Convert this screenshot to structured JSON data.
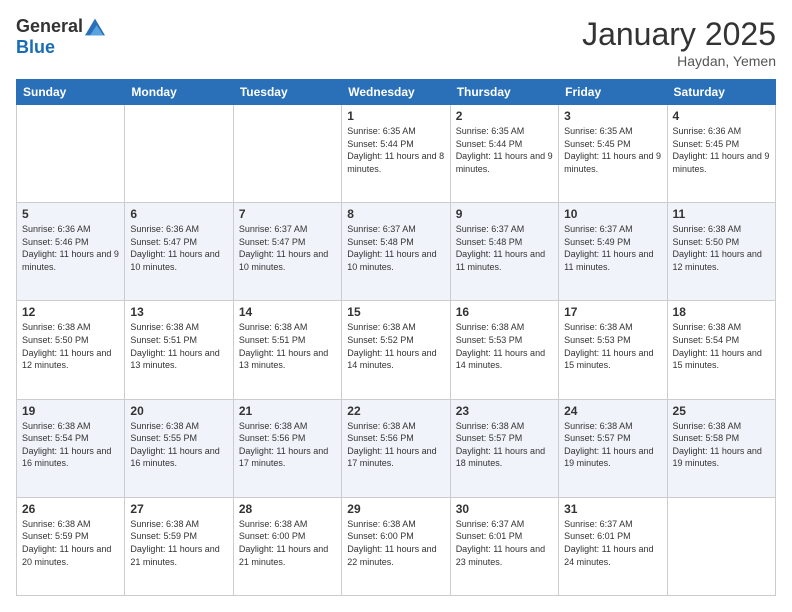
{
  "logo": {
    "general": "General",
    "blue": "Blue"
  },
  "header": {
    "month": "January 2025",
    "location": "Haydan, Yemen"
  },
  "weekdays": [
    "Sunday",
    "Monday",
    "Tuesday",
    "Wednesday",
    "Thursday",
    "Friday",
    "Saturday"
  ],
  "weeks": [
    [
      {
        "day": "",
        "sunrise": "",
        "sunset": "",
        "daylight": ""
      },
      {
        "day": "",
        "sunrise": "",
        "sunset": "",
        "daylight": ""
      },
      {
        "day": "",
        "sunrise": "",
        "sunset": "",
        "daylight": ""
      },
      {
        "day": "1",
        "sunrise": "Sunrise: 6:35 AM",
        "sunset": "Sunset: 5:44 PM",
        "daylight": "Daylight: 11 hours and 8 minutes."
      },
      {
        "day": "2",
        "sunrise": "Sunrise: 6:35 AM",
        "sunset": "Sunset: 5:44 PM",
        "daylight": "Daylight: 11 hours and 9 minutes."
      },
      {
        "day": "3",
        "sunrise": "Sunrise: 6:35 AM",
        "sunset": "Sunset: 5:45 PM",
        "daylight": "Daylight: 11 hours and 9 minutes."
      },
      {
        "day": "4",
        "sunrise": "Sunrise: 6:36 AM",
        "sunset": "Sunset: 5:45 PM",
        "daylight": "Daylight: 11 hours and 9 minutes."
      }
    ],
    [
      {
        "day": "5",
        "sunrise": "Sunrise: 6:36 AM",
        "sunset": "Sunset: 5:46 PM",
        "daylight": "Daylight: 11 hours and 9 minutes."
      },
      {
        "day": "6",
        "sunrise": "Sunrise: 6:36 AM",
        "sunset": "Sunset: 5:47 PM",
        "daylight": "Daylight: 11 hours and 10 minutes."
      },
      {
        "day": "7",
        "sunrise": "Sunrise: 6:37 AM",
        "sunset": "Sunset: 5:47 PM",
        "daylight": "Daylight: 11 hours and 10 minutes."
      },
      {
        "day": "8",
        "sunrise": "Sunrise: 6:37 AM",
        "sunset": "Sunset: 5:48 PM",
        "daylight": "Daylight: 11 hours and 10 minutes."
      },
      {
        "day": "9",
        "sunrise": "Sunrise: 6:37 AM",
        "sunset": "Sunset: 5:48 PM",
        "daylight": "Daylight: 11 hours and 11 minutes."
      },
      {
        "day": "10",
        "sunrise": "Sunrise: 6:37 AM",
        "sunset": "Sunset: 5:49 PM",
        "daylight": "Daylight: 11 hours and 11 minutes."
      },
      {
        "day": "11",
        "sunrise": "Sunrise: 6:38 AM",
        "sunset": "Sunset: 5:50 PM",
        "daylight": "Daylight: 11 hours and 12 minutes."
      }
    ],
    [
      {
        "day": "12",
        "sunrise": "Sunrise: 6:38 AM",
        "sunset": "Sunset: 5:50 PM",
        "daylight": "Daylight: 11 hours and 12 minutes."
      },
      {
        "day": "13",
        "sunrise": "Sunrise: 6:38 AM",
        "sunset": "Sunset: 5:51 PM",
        "daylight": "Daylight: 11 hours and 13 minutes."
      },
      {
        "day": "14",
        "sunrise": "Sunrise: 6:38 AM",
        "sunset": "Sunset: 5:51 PM",
        "daylight": "Daylight: 11 hours and 13 minutes."
      },
      {
        "day": "15",
        "sunrise": "Sunrise: 6:38 AM",
        "sunset": "Sunset: 5:52 PM",
        "daylight": "Daylight: 11 hours and 14 minutes."
      },
      {
        "day": "16",
        "sunrise": "Sunrise: 6:38 AM",
        "sunset": "Sunset: 5:53 PM",
        "daylight": "Daylight: 11 hours and 14 minutes."
      },
      {
        "day": "17",
        "sunrise": "Sunrise: 6:38 AM",
        "sunset": "Sunset: 5:53 PM",
        "daylight": "Daylight: 11 hours and 15 minutes."
      },
      {
        "day": "18",
        "sunrise": "Sunrise: 6:38 AM",
        "sunset": "Sunset: 5:54 PM",
        "daylight": "Daylight: 11 hours and 15 minutes."
      }
    ],
    [
      {
        "day": "19",
        "sunrise": "Sunrise: 6:38 AM",
        "sunset": "Sunset: 5:54 PM",
        "daylight": "Daylight: 11 hours and 16 minutes."
      },
      {
        "day": "20",
        "sunrise": "Sunrise: 6:38 AM",
        "sunset": "Sunset: 5:55 PM",
        "daylight": "Daylight: 11 hours and 16 minutes."
      },
      {
        "day": "21",
        "sunrise": "Sunrise: 6:38 AM",
        "sunset": "Sunset: 5:56 PM",
        "daylight": "Daylight: 11 hours and 17 minutes."
      },
      {
        "day": "22",
        "sunrise": "Sunrise: 6:38 AM",
        "sunset": "Sunset: 5:56 PM",
        "daylight": "Daylight: 11 hours and 17 minutes."
      },
      {
        "day": "23",
        "sunrise": "Sunrise: 6:38 AM",
        "sunset": "Sunset: 5:57 PM",
        "daylight": "Daylight: 11 hours and 18 minutes."
      },
      {
        "day": "24",
        "sunrise": "Sunrise: 6:38 AM",
        "sunset": "Sunset: 5:57 PM",
        "daylight": "Daylight: 11 hours and 19 minutes."
      },
      {
        "day": "25",
        "sunrise": "Sunrise: 6:38 AM",
        "sunset": "Sunset: 5:58 PM",
        "daylight": "Daylight: 11 hours and 19 minutes."
      }
    ],
    [
      {
        "day": "26",
        "sunrise": "Sunrise: 6:38 AM",
        "sunset": "Sunset: 5:59 PM",
        "daylight": "Daylight: 11 hours and 20 minutes."
      },
      {
        "day": "27",
        "sunrise": "Sunrise: 6:38 AM",
        "sunset": "Sunset: 5:59 PM",
        "daylight": "Daylight: 11 hours and 21 minutes."
      },
      {
        "day": "28",
        "sunrise": "Sunrise: 6:38 AM",
        "sunset": "Sunset: 6:00 PM",
        "daylight": "Daylight: 11 hours and 21 minutes."
      },
      {
        "day": "29",
        "sunrise": "Sunrise: 6:38 AM",
        "sunset": "Sunset: 6:00 PM",
        "daylight": "Daylight: 11 hours and 22 minutes."
      },
      {
        "day": "30",
        "sunrise": "Sunrise: 6:37 AM",
        "sunset": "Sunset: 6:01 PM",
        "daylight": "Daylight: 11 hours and 23 minutes."
      },
      {
        "day": "31",
        "sunrise": "Sunrise: 6:37 AM",
        "sunset": "Sunset: 6:01 PM",
        "daylight": "Daylight: 11 hours and 24 minutes."
      },
      {
        "day": "",
        "sunrise": "",
        "sunset": "",
        "daylight": ""
      }
    ]
  ]
}
